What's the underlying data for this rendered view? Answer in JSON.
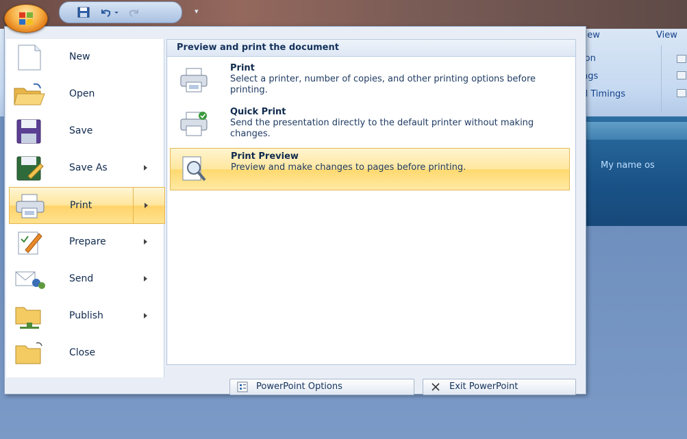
{
  "ribbon": {
    "tabs": [
      "view",
      "View"
    ],
    "items": [
      "ion",
      "ngs",
      "d Timings"
    ]
  },
  "slide": {
    "text": "My name os"
  },
  "office_menu": {
    "left_items": [
      {
        "label": "New",
        "icon": "new-document-icon",
        "has_submenu": false
      },
      {
        "label": "Open",
        "icon": "open-folder-icon",
        "has_submenu": false
      },
      {
        "label": "Save",
        "icon": "floppy-disk-icon",
        "has_submenu": false
      },
      {
        "label": "Save As",
        "icon": "save-as-icon",
        "has_submenu": true
      },
      {
        "label": "Print",
        "icon": "printer-icon",
        "has_submenu": true
      },
      {
        "label": "Prepare",
        "icon": "prepare-icon",
        "has_submenu": true
      },
      {
        "label": "Send",
        "icon": "send-icon",
        "has_submenu": true
      },
      {
        "label": "Publish",
        "icon": "publish-icon",
        "has_submenu": true
      },
      {
        "label": "Close",
        "icon": "close-folder-icon",
        "has_submenu": false
      }
    ],
    "active_item": "Print",
    "submenu": {
      "header": "Preview and print the document",
      "items": [
        {
          "title": "Print",
          "description": "Select a printer, number of copies, and other printing options before printing.",
          "icon": "printer-icon"
        },
        {
          "title": "Quick Print",
          "description": "Send the presentation directly to the default printer without making changes.",
          "icon": "quick-print-icon"
        },
        {
          "title": "Print Preview",
          "description": "Preview and make changes to pages before printing.",
          "icon": "print-preview-icon"
        }
      ],
      "highlighted": "Print Preview"
    },
    "footer": {
      "options_label": "PowerPoint Options",
      "exit_label": "Exit PowerPoint"
    }
  },
  "colors": {
    "highlight": "#ffe59b",
    "menu_text": "#0f2a4d",
    "ribbon_bg": "#c5d9f1"
  }
}
